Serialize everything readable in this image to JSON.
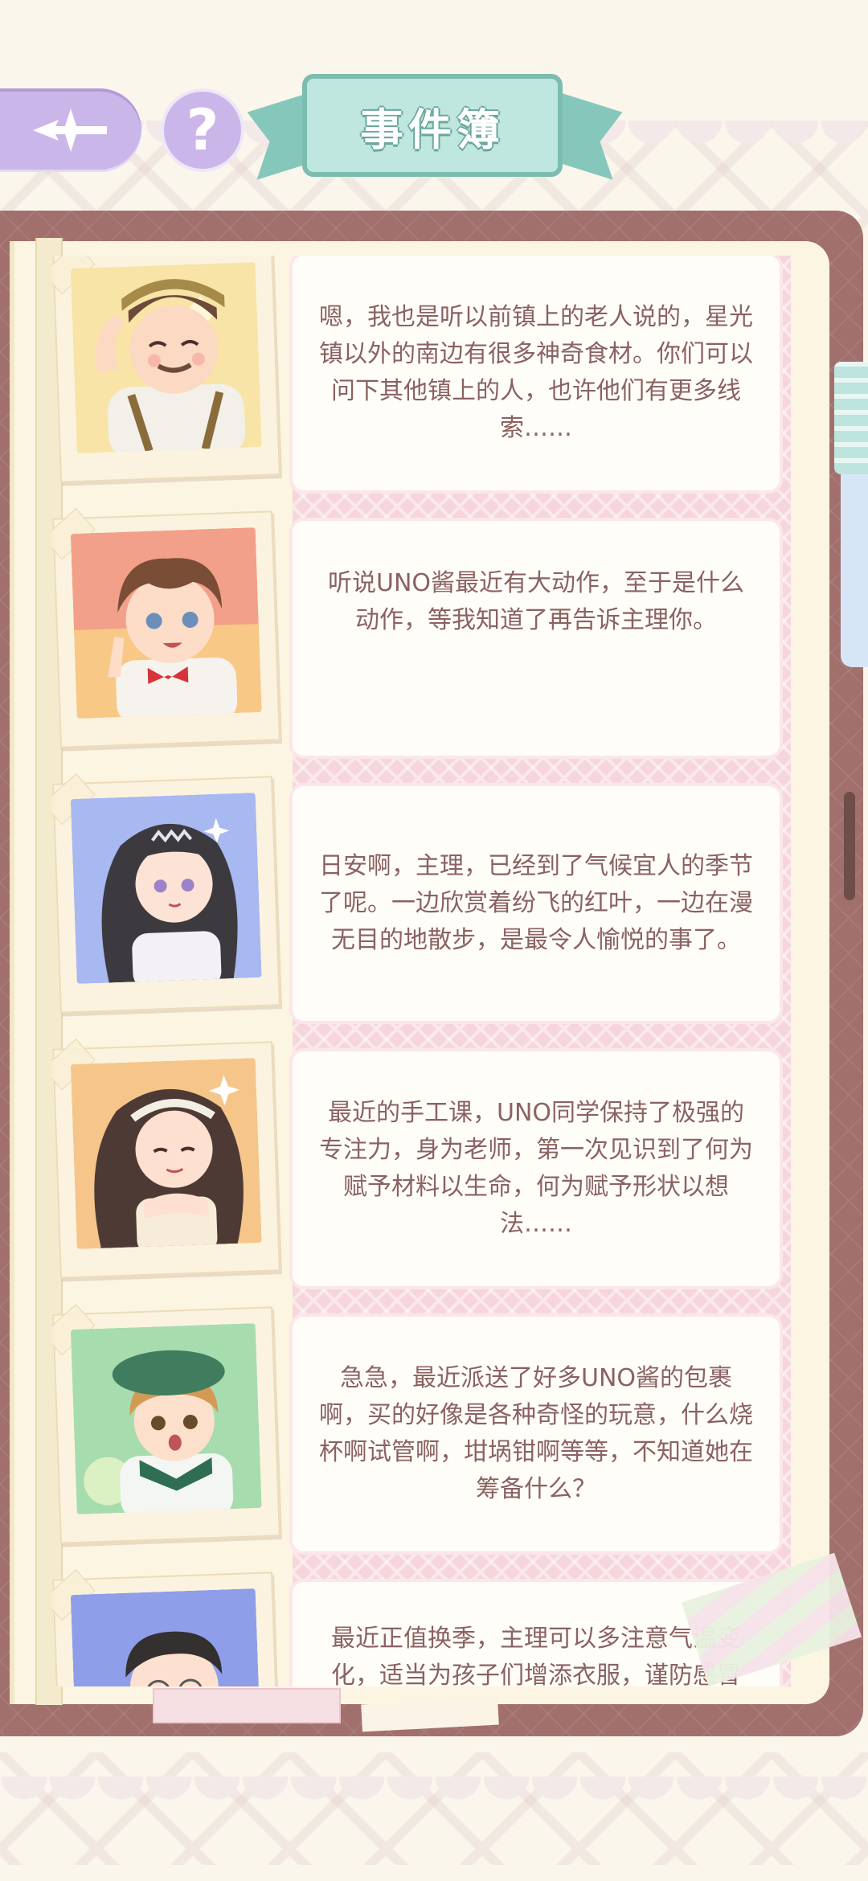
{
  "header": {
    "title": "事件簿",
    "help_label": "?"
  },
  "entries": [
    {
      "character": "mustache-man-in-cap",
      "text": "嗯，我也是听以前镇上的老人说的，星光镇以外的南边有很多神奇食材。你们可以问下其他镇上的人，也许他们有更多线索……"
    },
    {
      "character": "curly-hair-boy-with-bowtie",
      "text": "听说UNO酱最近有大动作，至于是什么动作，等我知道了再告诉主理你。"
    },
    {
      "character": "long-black-hair-girl-with-tiara",
      "text": "日安啊，主理，已经到了气候宜人的季节了呢。一边欣赏着纷飞的红叶，一边在漫无目的地散步，是最令人愉悦的事了。"
    },
    {
      "character": "wavy-hair-teacher-with-headband",
      "text": "最近的手工课，UNO同学保持了极强的专注力，身为老师，第一次见识到了何为赋予材料以生命，何为赋予形状以想法……"
    },
    {
      "character": "boy-in-green-beret",
      "text": "急急，最近派送了好多UNO酱的包裹啊，买的好像是各种奇怪的玩意，什么烧杯啊试管啊，坩埚钳啊等等，不知道她在筹备什么？"
    },
    {
      "character": "man-with-glasses",
      "text": "最近正值换季，主理可以多注意气温变化，适当为孩子们增添衣服，谨防感冒"
    }
  ],
  "colors": {
    "accent_purple": "#cbb6ea",
    "ribbon_teal": "#86c7bb",
    "book_brown": "#a1706d",
    "text_color": "#8a6262"
  }
}
